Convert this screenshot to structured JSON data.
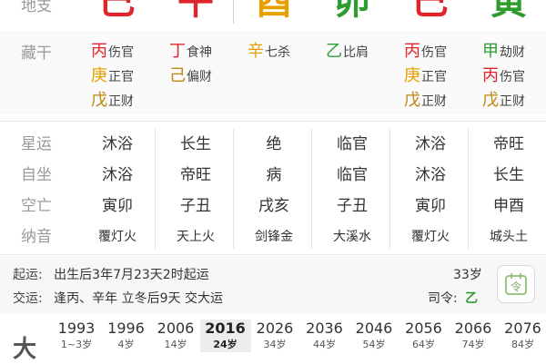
{
  "top_row": {
    "label": "地支",
    "branches": [
      {
        "char": "巳",
        "color": "#e0242c"
      },
      {
        "char": "午",
        "color": "#e0242c"
      },
      {
        "char": "酉",
        "color": "#e8a000"
      },
      {
        "char": "卯",
        "color": "#2e9c2e"
      },
      {
        "char": "巳",
        "color": "#e0242c"
      },
      {
        "char": "寅",
        "color": "#2e9c2e"
      }
    ]
  },
  "canggan": {
    "label": "藏干",
    "columns": [
      [
        {
          "stem": "丙",
          "god": "伤官",
          "color": "#e0242c"
        },
        {
          "stem": "庚",
          "god": "正官",
          "color": "#e8a000"
        },
        {
          "stem": "戊",
          "god": "正财",
          "color": "#b8860b"
        }
      ],
      [
        {
          "stem": "丁",
          "god": "食神",
          "color": "#e0242c"
        },
        {
          "stem": "己",
          "god": "偏财",
          "color": "#b8860b"
        }
      ],
      [
        {
          "stem": "辛",
          "god": "七杀",
          "color": "#e8a000"
        }
      ],
      [
        {
          "stem": "乙",
          "god": "比肩",
          "color": "#2e9c2e"
        }
      ],
      [
        {
          "stem": "丙",
          "god": "伤官",
          "color": "#e0242c"
        },
        {
          "stem": "庚",
          "god": "正官",
          "color": "#e8a000"
        },
        {
          "stem": "戊",
          "god": "正财",
          "color": "#b8860b"
        }
      ],
      [
        {
          "stem": "甲",
          "god": "劫财",
          "color": "#2e9c2e"
        },
        {
          "stem": "丙",
          "god": "伤官",
          "color": "#e0242c"
        },
        {
          "stem": "戊",
          "god": "正财",
          "color": "#b8860b"
        }
      ]
    ]
  },
  "rows": [
    {
      "label": "星运",
      "values": [
        "沐浴",
        "长生",
        "绝",
        "临官",
        "沐浴",
        "帝旺"
      ]
    },
    {
      "label": "自坐",
      "values": [
        "沐浴",
        "帝旺",
        "病",
        "临官",
        "沐浴",
        "长生"
      ]
    },
    {
      "label": "空亡",
      "values": [
        "寅卯",
        "子丑",
        "戌亥",
        "子丑",
        "寅卯",
        "申酉"
      ]
    },
    {
      "label": "纳音",
      "values": [
        "覆灯火",
        "天上火",
        "剑锋金",
        "大溪水",
        "覆灯火",
        "城头土"
      ]
    }
  ],
  "yun": {
    "qiyun_label": "起运:",
    "qiyun_text": "出生后3年7月23天2时起运",
    "age": "33岁",
    "jiaoyun_label": "交运:",
    "jiaoyun_text": "逢丙、辛年 立冬后9天 交大运",
    "siling_label": "司令:",
    "siling_value": "乙",
    "ling_button": "令"
  },
  "dayun": {
    "label": "大",
    "items": [
      {
        "year": "1993",
        "age": "1~3岁"
      },
      {
        "year": "1996",
        "age": "4岁"
      },
      {
        "year": "2006",
        "age": "14岁"
      },
      {
        "year": "2016",
        "age": "24岁"
      },
      {
        "year": "2026",
        "age": "34岁"
      },
      {
        "year": "2036",
        "age": "44岁"
      },
      {
        "year": "2046",
        "age": "54岁"
      },
      {
        "year": "2056",
        "age": "64岁"
      },
      {
        "year": "2066",
        "age": "74岁"
      },
      {
        "year": "2076",
        "age": "84岁"
      }
    ],
    "active_index": 3
  }
}
